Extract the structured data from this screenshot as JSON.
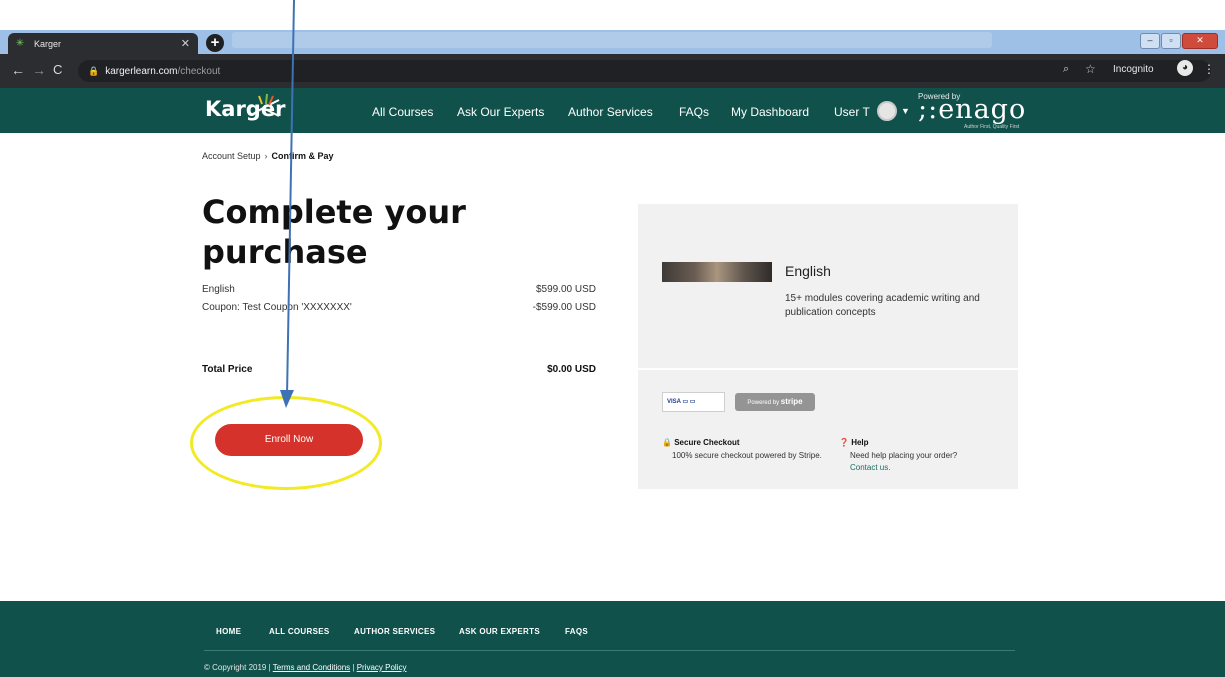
{
  "browser": {
    "tab_title": "Karger",
    "url_host": "kargerlearn.com",
    "url_path": "/checkout",
    "incognito_label": "Incognito"
  },
  "header": {
    "logo_text": "Karger",
    "nav": [
      "All Courses",
      "Ask Our Experts",
      "Author Services",
      "FAQs",
      "My Dashboard"
    ],
    "user_label": "User T",
    "powered_by": "Powered by",
    "partner_name": "enago",
    "partner_tagline": "Author First, Quality First"
  },
  "breadcrumb": {
    "step1": "Account Setup",
    "step2": "Confirm & Pay"
  },
  "checkout": {
    "title": "Complete your purchase",
    "items": [
      {
        "label": "English",
        "amount": "$599.00 USD"
      },
      {
        "label": "Coupon: Test Coupon 'XXXXXXX'",
        "amount": "-$599.00 USD"
      }
    ],
    "total_label": "Total Price",
    "total_amount": "$0.00 USD",
    "enroll_label": "Enroll Now"
  },
  "summary": {
    "course_name": "English",
    "course_desc": "15+ modules covering academic writing and publication concepts",
    "cards_label": "VISA",
    "stripe_prefix": "Powered by",
    "stripe_brand": "stripe",
    "secure_title": "Secure Checkout",
    "secure_text": "100% secure checkout powered by Stripe.",
    "help_title": "Help",
    "help_text": "Need help placing your order?",
    "help_link": "Contact us."
  },
  "footer": {
    "nav": [
      "HOME",
      "ALL COURSES",
      "AUTHOR SERVICES",
      "ASK OUR EXPERTS",
      "FAQS"
    ],
    "copyright": "© Copyright 2019 |",
    "terms": "Terms and Conditions",
    "sep": "|",
    "privacy": "Privacy Policy"
  },
  "colors": {
    "brand_green": "#10524b",
    "enroll_red": "#d4322a",
    "highlight_yellow": "#f2ea24",
    "annotation_arrow": "#3f72b5"
  }
}
